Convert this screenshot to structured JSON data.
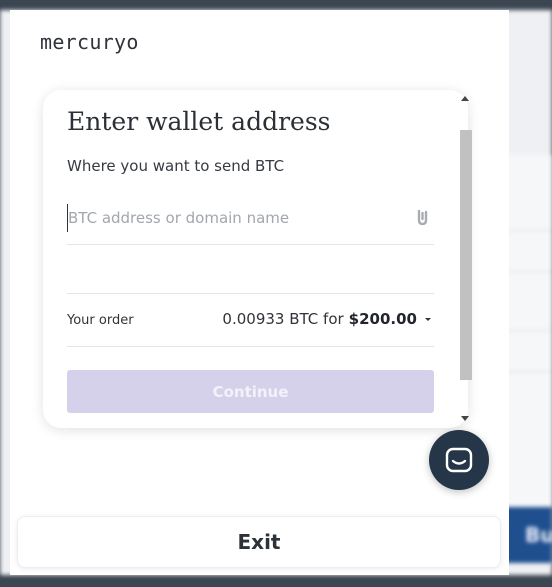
{
  "brand": {
    "name": "mercuryo"
  },
  "card": {
    "title": "Enter wallet address",
    "subtitle": "Where you want to send BTC",
    "address_placeholder": "BTC address or domain name",
    "order_label": "Your order",
    "order_crypto": "0.00933 BTC for",
    "order_fiat": "$200.00",
    "continue_label": "Continue"
  },
  "exit_label": "Exit",
  "background": {
    "buy_label": "Bu"
  },
  "colors": {
    "continue_disabled": "#d6d1ea",
    "chat_button": "#263649",
    "background_buy": "#1f4f8f"
  },
  "icons": [
    "paste-icon",
    "chevron-down-icon",
    "chat-icon"
  ]
}
